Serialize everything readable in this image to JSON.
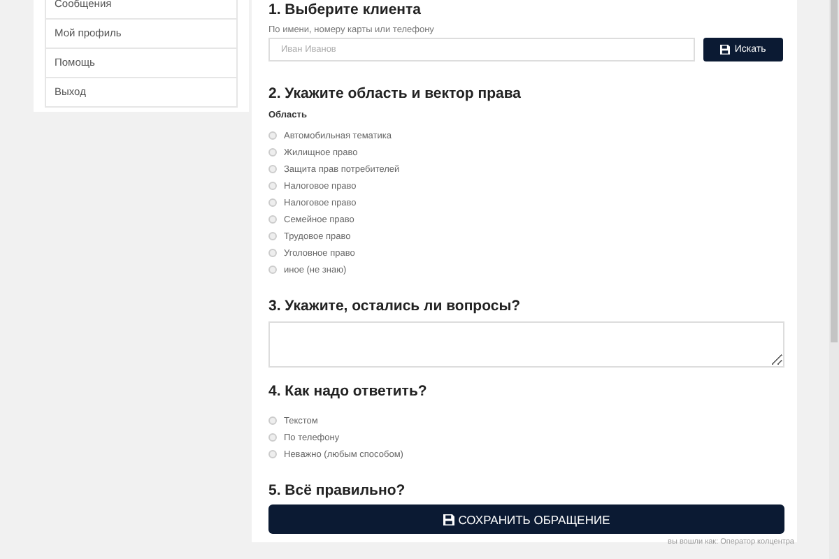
{
  "sidebar": {
    "items": [
      {
        "label": "Сообщения"
      },
      {
        "label": "Мой профиль"
      },
      {
        "label": "Помощь"
      },
      {
        "label": "Выход"
      }
    ]
  },
  "form": {
    "step1": {
      "title": "1. Выберите клиента",
      "hint": "По имени, номеру карты или телефону",
      "search": {
        "placeholder": "Иван Иванов"
      },
      "button": "Искать"
    },
    "step2": {
      "title": "2. Укажите область и вектор права",
      "label": "Область",
      "options": [
        {
          "label": "Автомобильная тематика",
          "selected": false
        },
        {
          "label": "Жилищное право",
          "selected": false
        },
        {
          "label": "Защита прав потребителей",
          "selected": false
        },
        {
          "label": "Налоговое право",
          "selected": false
        },
        {
          "label": "Налоговое право",
          "selected": false
        },
        {
          "label": "Семейное право",
          "selected": false
        },
        {
          "label": "Трудовое право",
          "selected": false
        },
        {
          "label": "Уголовное право",
          "selected": false
        },
        {
          "label": "иное (не знаю)",
          "selected": false
        }
      ]
    },
    "step3": {
      "title": "3. Укажите, остались ли вопросы?"
    },
    "step4": {
      "title": "4. Как надо ответить?",
      "options": [
        {
          "label": "Текстом",
          "selected": false
        },
        {
          "label": "По телефону",
          "selected": false
        },
        {
          "label": "Неважно (любым способом)",
          "selected": false
        }
      ]
    },
    "step5": {
      "title": "5. Всё правильно?",
      "button": "СОХРАНИТЬ ОБРАЩЕНИЕ"
    }
  },
  "footer": {
    "text": "вы вошли как: Оператор колцентра"
  }
}
